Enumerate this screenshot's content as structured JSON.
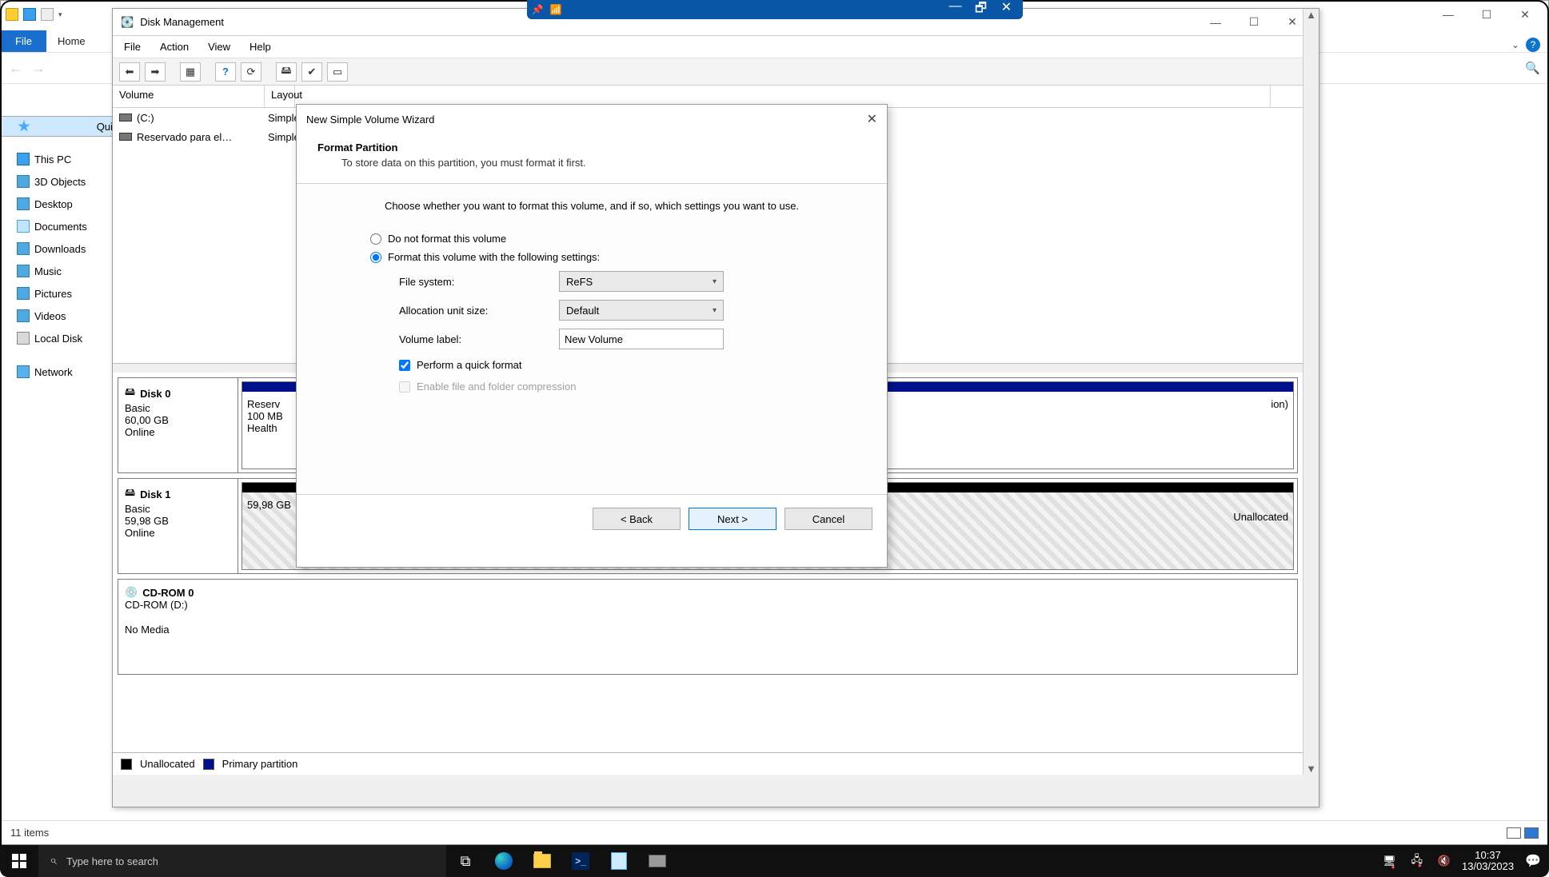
{
  "rdp": {
    "pin": "📌",
    "signal": "📶"
  },
  "explorer": {
    "file_tab": "File",
    "home_tab": "Home",
    "tree": [
      {
        "label": "Quick access",
        "cls": "ic-star",
        "sel": true
      },
      {
        "label": "This PC",
        "cls": "ic-pc"
      },
      {
        "label": "3D Objects",
        "cls": "ic-fold2"
      },
      {
        "label": "Desktop",
        "cls": "ic-fold2"
      },
      {
        "label": "Documents",
        "cls": "ic-note"
      },
      {
        "label": "Downloads",
        "cls": "ic-fold2"
      },
      {
        "label": "Music",
        "cls": "ic-fold2"
      },
      {
        "label": "Pictures",
        "cls": "ic-fold2"
      },
      {
        "label": "Videos",
        "cls": "ic-fold2"
      },
      {
        "label": "Local Disk",
        "cls": "ic-disk"
      },
      {
        "label": "Network",
        "cls": "ic-net"
      }
    ],
    "status": "11 items"
  },
  "dm": {
    "title": "Disk Management",
    "menu": [
      "File",
      "Action",
      "View",
      "Help"
    ],
    "cols": {
      "vol": "Volume",
      "lay": "Layout"
    },
    "rows": [
      {
        "name": "(C:)",
        "lay": "Simple"
      },
      {
        "name": "Reservado para el…",
        "lay": "Simple"
      }
    ],
    "disks": [
      {
        "name": "Disk 0",
        "type": "Basic",
        "size": "60,00 GB",
        "status": "Online",
        "parts": [
          {
            "bar": "primary",
            "small": true,
            "l1": "Reserv",
            "l2": "100 MB",
            "l3": "Health"
          },
          {
            "bar": "primary",
            "l3": "ion)"
          }
        ]
      },
      {
        "name": "Disk 1",
        "type": "Basic",
        "size": "59,98 GB",
        "status": "Online",
        "parts": [
          {
            "bar": "black",
            "hatched": true,
            "l1": "",
            "l2": "59,98 GB",
            "l3": "Unallocated"
          }
        ]
      },
      {
        "name": "CD-ROM 0",
        "type": "CD-ROM (D:)",
        "size": "",
        "status": "No Media",
        "parts": []
      }
    ],
    "legend": {
      "unalloc": "Unallocated",
      "primary": "Primary partition"
    }
  },
  "wizard": {
    "title": "New Simple Volume Wizard",
    "heading": "Format Partition",
    "sub": "To store data on this partition, you must format it first.",
    "instruction": "Choose whether you want to format this volume, and if so, which settings you want to use.",
    "opt_no": "Do not format this volume",
    "opt_yes": "Format this volume with the following settings:",
    "fs_label": "File system:",
    "fs_value": "ReFS",
    "au_label": "Allocation unit size:",
    "au_value": "Default",
    "vl_label": "Volume label:",
    "vl_value": "New Volume",
    "quick": "Perform a quick format",
    "compress": "Enable file and folder compression",
    "back": "< Back",
    "next": "Next >",
    "cancel": "Cancel"
  },
  "taskbar": {
    "search_placeholder": "Type here to search",
    "time": "10:37",
    "date": "13/03/2023"
  }
}
